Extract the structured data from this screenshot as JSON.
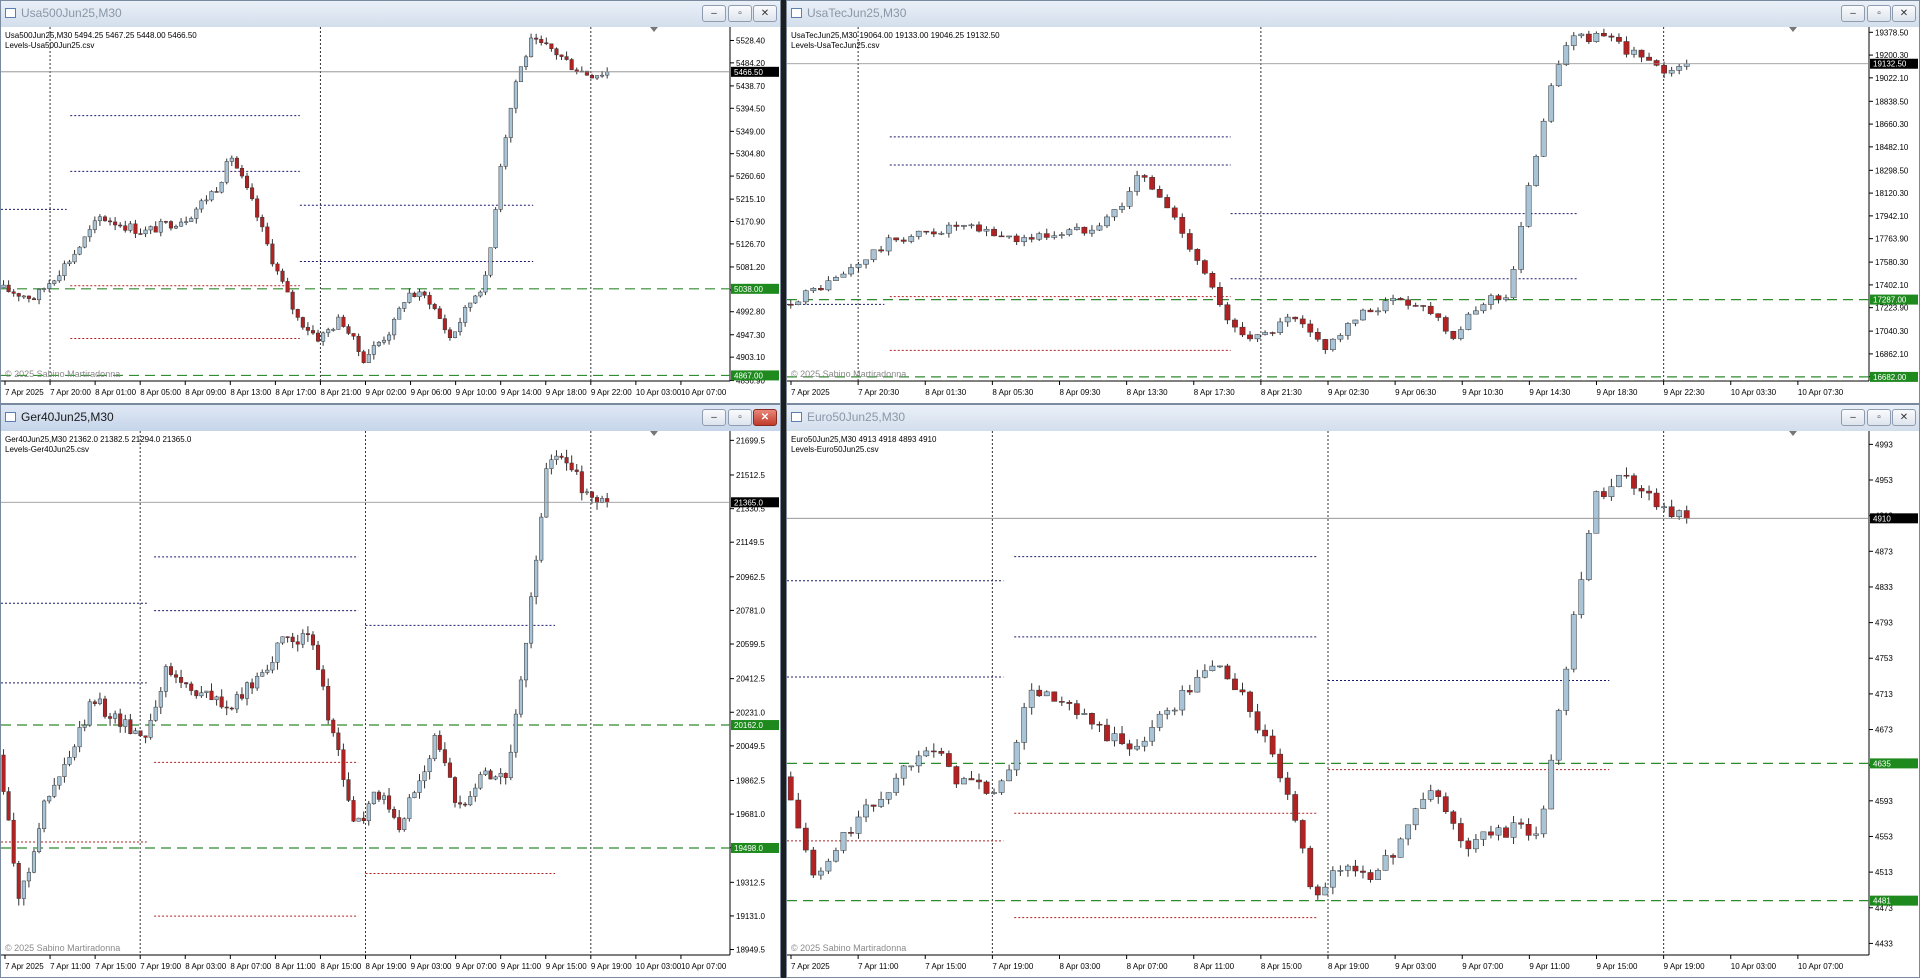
{
  "colors": {
    "bull": "#a9c4d6",
    "bear": "#b22222",
    "upper": "#1c1c6e",
    "lower": "#b22222",
    "support": "#2e8b2e",
    "price_tag": "#000000",
    "level_tag": "#1e8a1e"
  },
  "windows": [
    {
      "id": "spx",
      "title": "Usa500Jun25,M30",
      "active": false,
      "close_red": false,
      "chart_data": {
        "type": "candlestick",
        "symbol": "Usa500Jun25,M30",
        "ohlc": "5494.25 5467.25 5448.00 5466.50",
        "title": "Usa500Jun25,M30  5494.25 5467.25 5448.00 5466.50",
        "subtitle": "Levels-Usa500Jun25.csv",
        "watermark": "© 2025 Sabino Martiradonna",
        "ylim": [
          4856,
          5555
        ],
        "yticks": [
          "5528.40",
          "5484.20",
          "5438.70",
          "5394.50",
          "5349.00",
          "5304.80",
          "5260.60",
          "5215.10",
          "5170.90",
          "5126.70",
          "5081.20",
          "5036.00",
          "4992.80",
          "4947.30",
          "4903.10",
          "4856.90"
        ],
        "ytick_values": [
          5528.4,
          5484.2,
          5438.7,
          5394.5,
          5349.0,
          5304.8,
          5260.6,
          5215.1,
          5170.9,
          5126.7,
          5081.2,
          5036.0,
          4992.8,
          4947.3,
          4903.1,
          4856.9
        ],
        "xticks": [
          "7 Apr 2025",
          "7 Apr 20:00",
          "8 Apr 01:00",
          "8 Apr 05:00",
          "8 Apr 09:00",
          "8 Apr 13:00",
          "8 Apr 17:00",
          "8 Apr 21:00",
          "9 Apr 02:00",
          "9 Apr 06:00",
          "9 Apr 10:00",
          "9 Apr 14:00",
          "9 Apr 18:00",
          "9 Apr 22:00",
          "10 Apr 03:00",
          "10 Apr 07:00"
        ],
        "session_breaks": [
          1,
          7,
          13
        ],
        "current_price": 5466.5,
        "current_label": "5466.50",
        "support_levels": [
          {
            "value": 5038,
            "label": "5038.00"
          },
          {
            "value": 4867,
            "label": "4867.00"
          }
        ],
        "upper_levels": [
          [
            0,
            0.09,
            5195
          ],
          [
            0.095,
            0.41,
            5380
          ],
          [
            0.095,
            0.41,
            5270
          ],
          [
            0.41,
            0.73,
            5203
          ],
          [
            0.41,
            0.73,
            5092
          ]
        ],
        "lower_levels": [
          [
            0.095,
            0.41,
            5044
          ],
          [
            0.095,
            0.41,
            4940
          ]
        ],
        "price_path": [
          [
            0,
            5040
          ],
          [
            0.05,
            5020
          ],
          [
            0.1,
            5100
          ],
          [
            0.14,
            5180
          ],
          [
            0.2,
            5150
          ],
          [
            0.26,
            5180
          ],
          [
            0.3,
            5240
          ],
          [
            0.32,
            5300
          ],
          [
            0.35,
            5200
          ],
          [
            0.38,
            5080
          ],
          [
            0.41,
            4980
          ],
          [
            0.44,
            4940
          ],
          [
            0.47,
            4980
          ],
          [
            0.5,
            4900
          ],
          [
            0.54,
            4960
          ],
          [
            0.56,
            5030
          ],
          [
            0.59,
            5020
          ],
          [
            0.62,
            4940
          ],
          [
            0.65,
            5020
          ],
          [
            0.67,
            5060
          ],
          [
            0.69,
            5300
          ],
          [
            0.71,
            5450
          ],
          [
            0.73,
            5525
          ],
          [
            0.76,
            5510
          ],
          [
            0.79,
            5475
          ],
          [
            0.81,
            5462
          ],
          [
            0.835,
            5466
          ]
        ]
      }
    },
    {
      "id": "ndx",
      "title": "UsaTecJun25,M30",
      "active": false,
      "close_red": false,
      "chart_data": {
        "type": "candlestick",
        "symbol": "UsaTecJun25,M30",
        "ohlc": "19064.00 19133.00 19046.25 19132.50",
        "title": "UsaTecJun25,M30  19064.00 19133.00 19046.25 19132.50",
        "subtitle": "Levels-UsaTecJun25.csv",
        "watermark": "© 2025 Sabino Martiradonna",
        "ylim": [
          16650,
          19420
        ],
        "yticks": [
          "19378.50",
          "19200.30",
          "19022.10",
          "18838.50",
          "18660.30",
          "18482.10",
          "18298.50",
          "18120.30",
          "17942.10",
          "17763.90",
          "17580.30",
          "17402.10",
          "17223.90",
          "17040.30",
          "16862.10",
          "16683.90"
        ],
        "ytick_values": [
          19378.5,
          19200.3,
          19022.1,
          18838.5,
          18660.3,
          18482.1,
          18298.5,
          18120.3,
          17942.1,
          17763.9,
          17580.3,
          17402.1,
          17223.9,
          17040.3,
          16862.1,
          16683.9
        ],
        "xticks": [
          "7 Apr 2025",
          "7 Apr 20:30",
          "8 Apr 01:30",
          "8 Apr 05:30",
          "8 Apr 09:30",
          "8 Apr 13:30",
          "8 Apr 17:30",
          "8 Apr 21:30",
          "9 Apr 02:30",
          "9 Apr 06:30",
          "9 Apr 10:30",
          "9 Apr 14:30",
          "9 Apr 18:30",
          "9 Apr 22:30",
          "10 Apr 03:30",
          "10 Apr 07:30"
        ],
        "session_breaks": [
          1,
          7,
          13
        ],
        "current_price": 19132.5,
        "current_label": "19132.50",
        "support_levels": [
          {
            "value": 17287,
            "label": "17287.00"
          },
          {
            "value": 16682,
            "label": "16682.00"
          }
        ],
        "upper_levels": [
          [
            0,
            0.09,
            17250
          ],
          [
            0.095,
            0.41,
            18560
          ],
          [
            0.095,
            0.41,
            18340
          ],
          [
            0.41,
            0.73,
            17960
          ],
          [
            0.41,
            0.73,
            17450
          ]
        ],
        "lower_levels": [
          [
            0.095,
            0.41,
            17310
          ],
          [
            0.095,
            0.41,
            16890
          ]
        ],
        "price_path": [
          [
            0,
            17250
          ],
          [
            0.05,
            17450
          ],
          [
            0.1,
            17750
          ],
          [
            0.16,
            17860
          ],
          [
            0.22,
            17760
          ],
          [
            0.28,
            17840
          ],
          [
            0.31,
            18000
          ],
          [
            0.33,
            18280
          ],
          [
            0.36,
            17950
          ],
          [
            0.39,
            17500
          ],
          [
            0.41,
            17100
          ],
          [
            0.44,
            16980
          ],
          [
            0.47,
            17140
          ],
          [
            0.5,
            16920
          ],
          [
            0.54,
            17200
          ],
          [
            0.57,
            17300
          ],
          [
            0.6,
            17200
          ],
          [
            0.62,
            17000
          ],
          [
            0.65,
            17300
          ],
          [
            0.67,
            17320
          ],
          [
            0.69,
            18200
          ],
          [
            0.71,
            19000
          ],
          [
            0.73,
            19360
          ],
          [
            0.76,
            19330
          ],
          [
            0.79,
            19200
          ],
          [
            0.81,
            19070
          ],
          [
            0.835,
            19132
          ]
        ]
      }
    },
    {
      "id": "dax",
      "title": "Ger40Jun25,M30",
      "active": true,
      "close_red": true,
      "chart_data": {
        "type": "candlestick",
        "symbol": "Ger40Jun25,M30",
        "ohlc": "21362.0 21382.5 21294.0 21365.0",
        "title": "Ger40Jun25,M30  21362.0 21382.5 21294.0 21365.0",
        "subtitle": "Levels-Ger40Jun25.csv",
        "watermark": "© 2025 Sabino Martiradonna",
        "ylim": [
          18920,
          21750
        ],
        "yticks": [
          "21699.5",
          "21512.5",
          "21330.5",
          "21149.5",
          "20962.5",
          "20781.0",
          "20599.5",
          "20412.5",
          "20231.0",
          "20049.5",
          "19862.5",
          "19681.0",
          "19499.5",
          "19312.5",
          "19131.0",
          "18949.5"
        ],
        "ytick_values": [
          21699.5,
          21512.5,
          21330.5,
          21149.5,
          20962.5,
          20781.0,
          20599.5,
          20412.5,
          20231.0,
          20049.5,
          19862.5,
          19681.0,
          19499.5,
          19312.5,
          19131.0,
          18949.5
        ],
        "xticks": [
          "7 Apr 2025",
          "7 Apr 11:00",
          "7 Apr 15:00",
          "7 Apr 19:00",
          "8 Apr 03:00",
          "8 Apr 07:00",
          "8 Apr 11:00",
          "8 Apr 15:00",
          "8 Apr 19:00",
          "9 Apr 03:00",
          "9 Apr 07:00",
          "9 Apr 11:00",
          "9 Apr 15:00",
          "9 Apr 19:00",
          "10 Apr 03:00",
          "10 Apr 07:00"
        ],
        "session_breaks": [
          3,
          8,
          13
        ],
        "current_price": 21365.0,
        "current_label": "21365.0",
        "support_levels": [
          {
            "value": 20162,
            "label": "20162.0"
          },
          {
            "value": 19498,
            "label": "19498.0"
          }
        ],
        "upper_levels": [
          [
            0,
            0.2,
            20820
          ],
          [
            0.21,
            0.49,
            21070
          ],
          [
            0.21,
            0.49,
            20780
          ],
          [
            0.5,
            0.76,
            20700
          ],
          [
            0,
            0.2,
            20390
          ]
        ],
        "lower_levels": [
          [
            0,
            0.2,
            19530
          ],
          [
            0.21,
            0.49,
            19960
          ],
          [
            0.21,
            0.49,
            19130
          ],
          [
            0.5,
            0.76,
            19360
          ]
        ],
        "price_path": [
          [
            0,
            20000
          ],
          [
            0.03,
            19200
          ],
          [
            0.06,
            19700
          ],
          [
            0.1,
            20000
          ],
          [
            0.13,
            20300
          ],
          [
            0.16,
            20200
          ],
          [
            0.2,
            20100
          ],
          [
            0.23,
            20450
          ],
          [
            0.27,
            20350
          ],
          [
            0.32,
            20250
          ],
          [
            0.36,
            20450
          ],
          [
            0.4,
            20650
          ],
          [
            0.43,
            20600
          ],
          [
            0.46,
            20100
          ],
          [
            0.49,
            19600
          ],
          [
            0.52,
            19800
          ],
          [
            0.55,
            19600
          ],
          [
            0.6,
            20100
          ],
          [
            0.63,
            19700
          ],
          [
            0.66,
            19900
          ],
          [
            0.7,
            19900
          ],
          [
            0.73,
            20800
          ],
          [
            0.75,
            21500
          ],
          [
            0.77,
            21650
          ],
          [
            0.8,
            21450
          ],
          [
            0.82,
            21380
          ],
          [
            0.835,
            21365
          ]
        ]
      }
    },
    {
      "id": "sx5e",
      "title": "Euro50Jun25,M30",
      "active": false,
      "close_red": false,
      "chart_data": {
        "type": "candlestick",
        "symbol": "Euro50Jun25,M30",
        "ohlc": "4913 4918 4893 4910",
        "title": "Euro50Jun25,M30  4913 4918 4893 4910",
        "subtitle": "Levels-Euro50Jun25.csv",
        "watermark": "© 2025 Sabino Martiradonna",
        "ylim": [
          4420,
          5008
        ],
        "yticks": [
          "4993",
          "4953",
          "4913",
          "4873",
          "4833",
          "4793",
          "4753",
          "4713",
          "4673",
          "4633",
          "4593",
          "4553",
          "4513",
          "4473",
          "4433"
        ],
        "ytick_values": [
          4993,
          4953,
          4913,
          4873,
          4833,
          4793,
          4753,
          4713,
          4673,
          4633,
          4593,
          4553,
          4513,
          4473,
          4433
        ],
        "xticks": [
          "7 Apr 2025",
          "7 Apr 11:00",
          "7 Apr 15:00",
          "7 Apr 19:00",
          "8 Apr 03:00",
          "8 Apr 07:00",
          "8 Apr 11:00",
          "8 Apr 15:00",
          "8 Apr 19:00",
          "9 Apr 03:00",
          "9 Apr 07:00",
          "9 Apr 11:00",
          "9 Apr 15:00",
          "9 Apr 19:00",
          "10 Apr 03:00",
          "10 Apr 07:00"
        ],
        "session_breaks": [
          3,
          8,
          13
        ],
        "current_price": 4910,
        "current_label": "4910",
        "support_levels": [
          {
            "value": 4635,
            "label": "4635"
          },
          {
            "value": 4481,
            "label": "4481"
          }
        ],
        "upper_levels": [
          [
            0,
            0.2,
            4840
          ],
          [
            0.21,
            0.49,
            4867
          ],
          [
            0.21,
            0.49,
            4777
          ],
          [
            0,
            0.2,
            4732
          ],
          [
            0.5,
            0.76,
            4728
          ]
        ],
        "lower_levels": [
          [
            0,
            0.2,
            4548
          ],
          [
            0.21,
            0.49,
            4579
          ],
          [
            0.21,
            0.49,
            4462
          ],
          [
            0.5,
            0.76,
            4628
          ]
        ],
        "price_path": [
          [
            0,
            4620
          ],
          [
            0.03,
            4500
          ],
          [
            0.06,
            4560
          ],
          [
            0.1,
            4610
          ],
          [
            0.13,
            4660
          ],
          [
            0.16,
            4620
          ],
          [
            0.2,
            4600
          ],
          [
            0.23,
            4720
          ],
          [
            0.27,
            4690
          ],
          [
            0.32,
            4650
          ],
          [
            0.36,
            4700
          ],
          [
            0.4,
            4750
          ],
          [
            0.43,
            4700
          ],
          [
            0.46,
            4620
          ],
          [
            0.49,
            4490
          ],
          [
            0.52,
            4520
          ],
          [
            0.55,
            4510
          ],
          [
            0.6,
            4610
          ],
          [
            0.63,
            4540
          ],
          [
            0.66,
            4560
          ],
          [
            0.7,
            4560
          ],
          [
            0.73,
            4800
          ],
          [
            0.75,
            4930
          ],
          [
            0.77,
            4960
          ],
          [
            0.8,
            4940
          ],
          [
            0.82,
            4915
          ],
          [
            0.835,
            4910
          ]
        ]
      }
    }
  ]
}
